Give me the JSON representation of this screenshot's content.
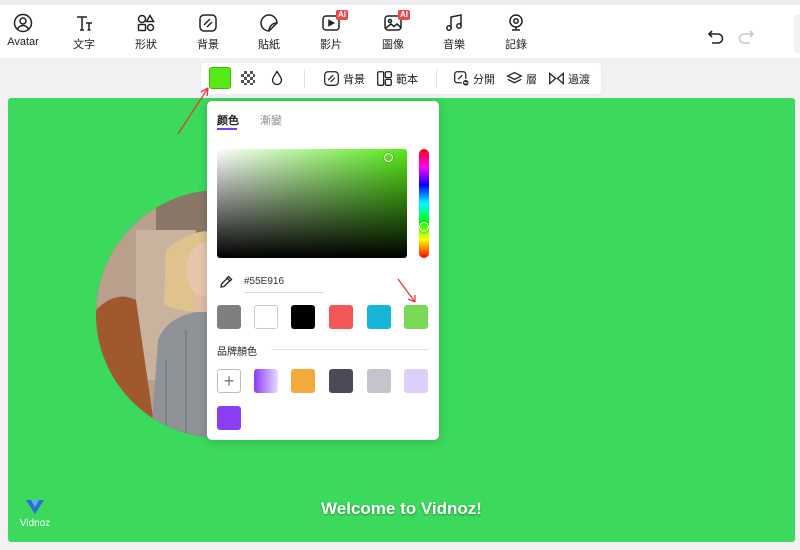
{
  "toolbar": {
    "items": [
      {
        "label": "Avatar",
        "icon": "avatar-icon",
        "ai": false
      },
      {
        "label": "文字",
        "icon": "text-icon",
        "ai": false
      },
      {
        "label": "形狀",
        "icon": "shapes-icon",
        "ai": false
      },
      {
        "label": "背景",
        "icon": "background-icon",
        "ai": false
      },
      {
        "label": "貼紙",
        "icon": "sticker-icon",
        "ai": false
      },
      {
        "label": "影片",
        "icon": "video-icon",
        "ai": true
      },
      {
        "label": "圖像",
        "icon": "image-icon",
        "ai": true
      },
      {
        "label": "音樂",
        "icon": "music-icon",
        "ai": false
      },
      {
        "label": "記錄",
        "icon": "record-icon",
        "ai": false
      }
    ],
    "ai_badge": "AI",
    "undo_icon": "undo-icon",
    "redo_icon": "redo-icon"
  },
  "subtoolbar": {
    "color": "#55e916",
    "background_label": "背景",
    "template_label": "範本",
    "split_label": "分開",
    "layer_label": "層",
    "transition_label": "過渡"
  },
  "picker": {
    "tab_color": "颜色",
    "tab_gradient": "漸變",
    "hex_value": "#55E916",
    "presets": [
      "#7f7f7f",
      "#ffffff",
      "#000000",
      "#f25656",
      "#17b6d8",
      "#7cd957"
    ],
    "brand_label": "品牌顏色",
    "brand_colors": [
      "linear-gradient(90deg,#8a3df5,#e9dcfb)",
      "#f3a93c",
      "#4b4b58",
      "#c4c4cc",
      "#dccffa",
      "#8c3ef7"
    ]
  },
  "canvas": {
    "background": "#3bda5c",
    "caption": "Welcome to Vidnoz!",
    "watermark": "Vidnoz"
  }
}
